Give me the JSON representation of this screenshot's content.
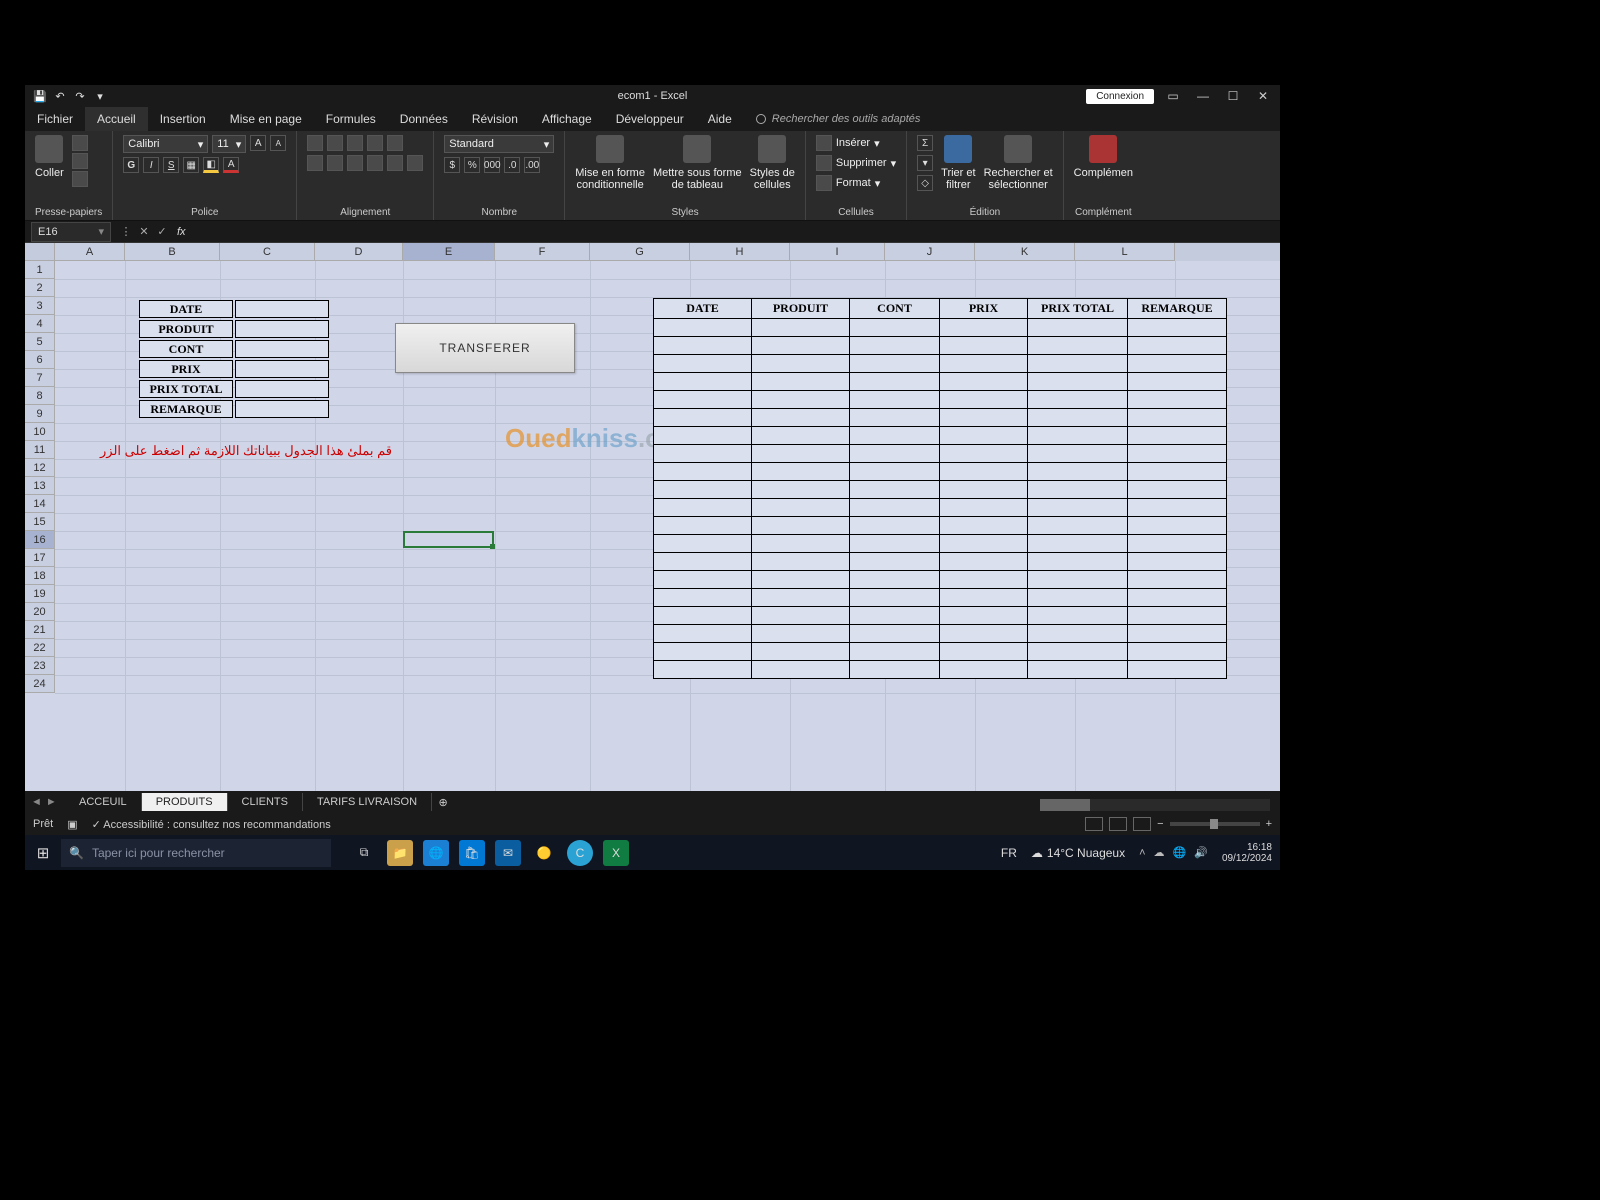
{
  "titlebar": {
    "title": "ecom1 - Excel",
    "login": "Connexion"
  },
  "tabs": [
    "Fichier",
    "Accueil",
    "Insertion",
    "Mise en page",
    "Formules",
    "Données",
    "Révision",
    "Affichage",
    "Développeur",
    "Aide"
  ],
  "tabs_active_index": 1,
  "tell_me": "Rechercher des outils adaptés",
  "ribbon": {
    "clipboard": {
      "paste": "Coller",
      "label": "Presse-papiers"
    },
    "font": {
      "name": "Calibri",
      "size": "11",
      "label": "Police"
    },
    "alignment": {
      "label": "Alignement"
    },
    "number": {
      "format": "Standard",
      "label": "Nombre"
    },
    "styles": {
      "cond": "Mise en forme\nconditionnelle",
      "table": "Mettre sous forme\nde tableau",
      "cell": "Styles de\ncellules",
      "label": "Styles"
    },
    "cells": {
      "insert": "Insérer",
      "delete": "Supprimer",
      "format": "Format",
      "label": "Cellules"
    },
    "editing": {
      "sort": "Trier et\nfiltrer",
      "find": "Rechercher et\nsélectionner",
      "label": "Édition"
    },
    "addins": {
      "label": "Complément",
      "label2": "Complémen"
    }
  },
  "namebox": "E16",
  "columns": [
    "A",
    "B",
    "C",
    "D",
    "E",
    "F",
    "G",
    "H",
    "I",
    "J",
    "K",
    "L"
  ],
  "row_count": 24,
  "input_table": {
    "labels": [
      "DATE",
      "PRODUIT",
      "CONT",
      "PRIX",
      "PRIX TOTAL",
      "REMARQUE"
    ]
  },
  "transfer_button": "TRANSFERER",
  "arabic_note": "قم بملئ هذا الجدول ببياناتك اللازمة ثم اضغط على الزر",
  "main_table_headers": [
    "DATE",
    "PRODUIT",
    "CONT",
    "PRIX",
    "PRIX TOTAL",
    "REMARQUE"
  ],
  "main_table_blank_rows": 20,
  "active_cell": "E16",
  "watermark": {
    "part1": "Oued",
    "part2": "kniss",
    "part3": ".com"
  },
  "sheet_tabs": [
    "ACCEUIL",
    "PRODUITS",
    "CLIENTS",
    "TARIFS LIVRAISON"
  ],
  "sheet_tabs_active_index": 1,
  "status": {
    "ready": "Prêt",
    "accessibility": "Accessibilité : consultez nos recommandations",
    "zoom": "100%"
  },
  "taskbar": {
    "search_placeholder": "Taper ici pour rechercher",
    "lang": "FR",
    "weather": "14°C  Nuageux",
    "time": "16:18",
    "date": "09/12/2024"
  }
}
